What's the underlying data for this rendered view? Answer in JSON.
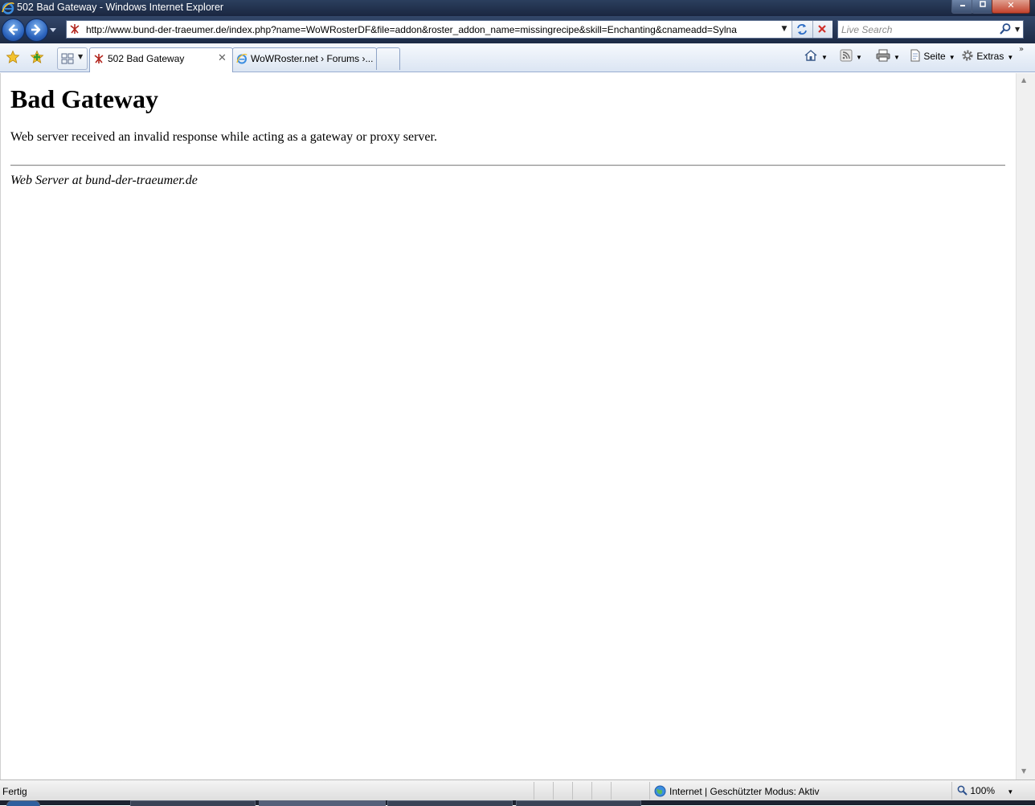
{
  "window": {
    "title": "502 Bad Gateway - Windows Internet Explorer",
    "minimize_icon": "minimize-icon",
    "maximize_icon": "maximize-icon",
    "close_label": "✕"
  },
  "navigation": {
    "address": "http://www.bund-der-traeumer.de/index.php?name=WoWRosterDF&file=addon&roster_addon_name=missingrecipe&skill=Enchanting&cnameadd=Sylna",
    "search_placeholder": "Live Search"
  },
  "tabs": [
    {
      "label": "502 Bad Gateway",
      "active": true
    },
    {
      "label": "WoWRoster.net › Forums ›...",
      "active": false
    }
  ],
  "commands": {
    "page_label": "Seite",
    "tools_label": "Extras"
  },
  "page": {
    "heading": "Bad Gateway",
    "message": "Web server received an invalid response while acting as a gateway or proxy server.",
    "footer": "Web Server at bund-der-traeumer.de"
  },
  "status": {
    "text": "Fertig",
    "zone": "Internet | Geschützter Modus: Aktiv",
    "zoom": "100%"
  },
  "colors": {
    "titlebar": "#1a2640",
    "accent": "#2c64bd"
  }
}
